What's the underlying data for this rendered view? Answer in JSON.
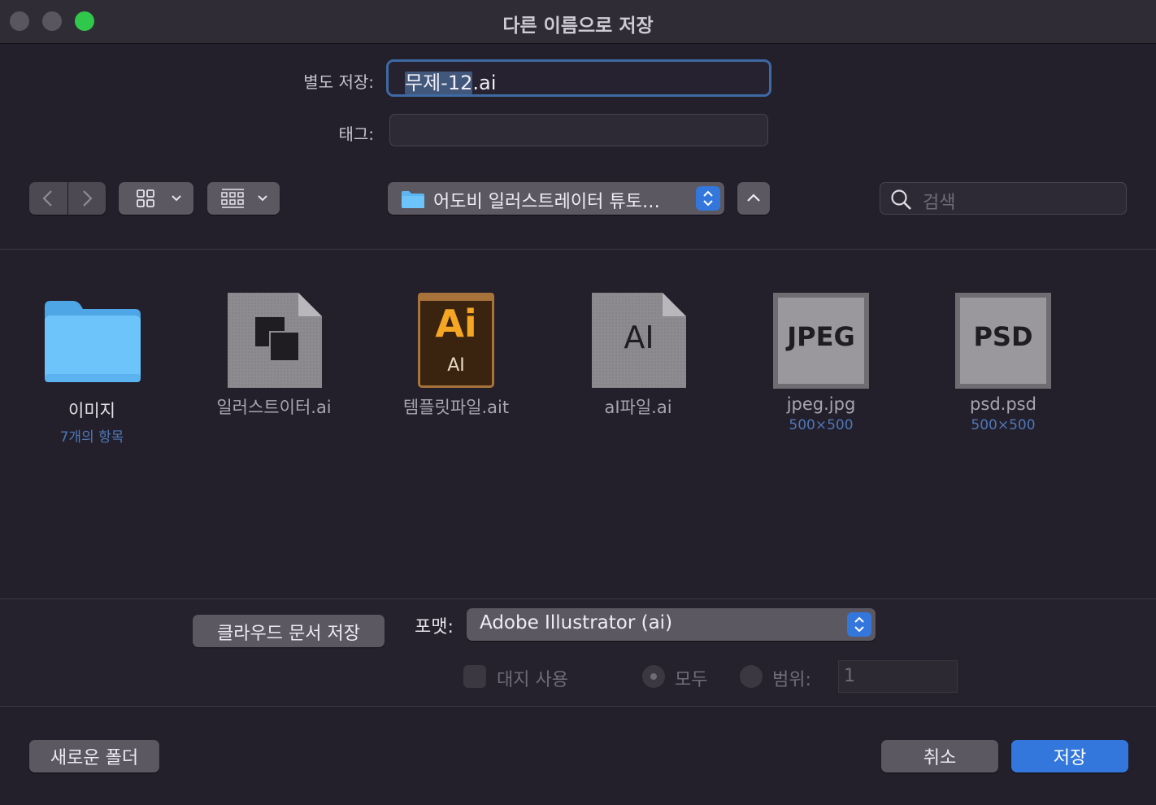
{
  "window": {
    "title": "다른 이름으로 저장",
    "traffic_colors": {
      "close": "#5a565e",
      "minimize": "#5a565e",
      "zoom": "#30c84a"
    }
  },
  "save_as": {
    "label": "별도 저장:",
    "value_selected": "무제-12",
    "value_ext": ".ai"
  },
  "tags": {
    "label": "태그:",
    "value": ""
  },
  "toolbar": {
    "location_name": "어도비 일러스트레이터 튜토…",
    "search_placeholder": "검색"
  },
  "files": [
    {
      "name": "이미지",
      "sub": "7개의 항목",
      "kind": "folder"
    },
    {
      "name": "일러스트이터.ai",
      "sub": "",
      "kind": "doc-layers"
    },
    {
      "name": "템플릿파일.ait",
      "sub": "",
      "kind": "ai-template"
    },
    {
      "name": "aI파일.ai",
      "sub": "",
      "kind": "doc-ai"
    },
    {
      "name": "jpeg.jpg",
      "sub": "500×500",
      "kind": "jpeg",
      "icon_text": "JPEG"
    },
    {
      "name": "psd.psd",
      "sub": "500×500",
      "kind": "psd",
      "icon_text": "PSD"
    }
  ],
  "ai_template_icon": {
    "big": "Ai",
    "small": "AI",
    "color": "#f5a623",
    "bg": "#3a2410",
    "border": "#a8733a"
  },
  "ai_doc_icon": {
    "text": "AI"
  },
  "options": {
    "cloud_button": "클라우드 문서 저장",
    "format_label": "포맷:",
    "format_value": "Adobe Illustrator (ai)",
    "artboards_label": "대지 사용",
    "all_label": "모두",
    "range_label": "범위:",
    "range_value": "1"
  },
  "footer": {
    "new_folder": "새로운 폴더",
    "cancel": "취소",
    "save": "저장"
  },
  "colors": {
    "accent": "#3377dc",
    "sub_text": "#4e78b8"
  }
}
